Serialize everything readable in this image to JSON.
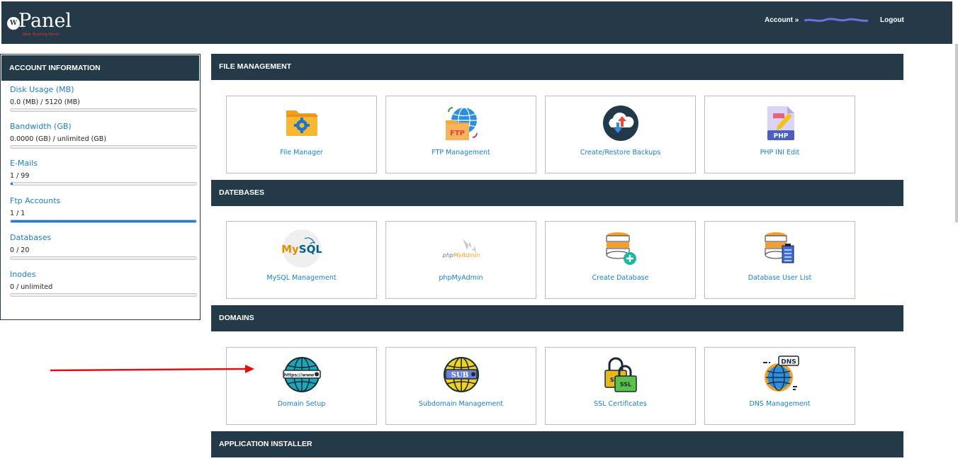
{
  "header": {
    "logo_text": "Panel",
    "logo_badge": "W",
    "logo_tagline": "Web Hosting Panel",
    "account_label": "Account »",
    "logout_label": "Logout"
  },
  "sidebar": {
    "title": "ACCOUNT INFORMATION",
    "stats": [
      {
        "label": "Disk Usage (MB)",
        "value": "0.0 (MB) / 5120 (MB)",
        "fill": 0.0
      },
      {
        "label": "Bandwidth (GB)",
        "value": "0.0000 (GB) / unlimited (GB)",
        "fill": 0.0
      },
      {
        "label": "E-Mails",
        "value": "1 / 99",
        "fill": 0.01
      },
      {
        "label": "Ftp Accounts",
        "value": "1 / 1",
        "fill": 1.0
      },
      {
        "label": "Databases",
        "value": "0 / 20",
        "fill": 0.0
      },
      {
        "label": "Inodes",
        "value": "0 / unlimited",
        "fill": 0.0
      }
    ]
  },
  "sections": {
    "file_management": {
      "title": "FILE MANAGEMENT",
      "items": [
        {
          "label": "File Manager",
          "icon": "folder-gear-icon"
        },
        {
          "label": "FTP Management",
          "icon": "ftp-globe-icon"
        },
        {
          "label": "Create/Restore Backups",
          "icon": "cloud-backup-icon"
        },
        {
          "label": "PHP INI Edit",
          "icon": "php-file-edit-icon"
        }
      ]
    },
    "databases": {
      "title": "DATEBASES",
      "items": [
        {
          "label": "MySQL Management",
          "icon": "mysql-logo-icon",
          "logo_text": "MySQL"
        },
        {
          "label": "phpMyAdmin",
          "icon": "phpmyadmin-logo-icon",
          "logo_text": "phpMyAdmin"
        },
        {
          "label": "Create Database",
          "icon": "database-add-icon"
        },
        {
          "label": "Database User List",
          "icon": "database-list-icon"
        }
      ]
    },
    "domains": {
      "title": "DOMAINS",
      "items": [
        {
          "label": "Domain Setup",
          "icon": "globe-https-icon",
          "badge": "https://www"
        },
        {
          "label": "Subdomain Management",
          "icon": "globe-sub-icon",
          "badge": "SUB"
        },
        {
          "label": "SSL Certificates",
          "icon": "ssl-lock-icon",
          "badge": "SSL"
        },
        {
          "label": "DNS Management",
          "icon": "dns-globe-icon",
          "badge": "DNS"
        }
      ]
    },
    "app_installer": {
      "title": "APPLICATION INSTALLER"
    }
  },
  "colors": {
    "header_bg": "#253a48",
    "link_blue": "#1a7fc1",
    "progress_blue": "#1a7ee0",
    "arrow_red": "#e01010"
  }
}
